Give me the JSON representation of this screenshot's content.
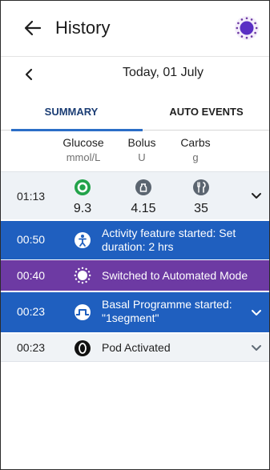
{
  "header": {
    "title": "History"
  },
  "date_nav": {
    "date_label": "Today, 01 July"
  },
  "tabs": [
    {
      "label": "SUMMARY",
      "active": true
    },
    {
      "label": "AUTO EVENTS",
      "active": false
    }
  ],
  "columns": {
    "glucose": {
      "label": "Glucose",
      "unit": "mmol/L"
    },
    "bolus": {
      "label": "Bolus",
      "unit": "U"
    },
    "carbs": {
      "label": "Carbs",
      "unit": "g"
    }
  },
  "summary_row": {
    "time": "01:13",
    "glucose": "9.3",
    "bolus": "4.15",
    "carbs": "35"
  },
  "events": {
    "activity": {
      "time": "00:50",
      "text": "Activity feature started: Set duration: 2 hrs",
      "icon": "activity-icon"
    },
    "automated": {
      "time": "00:40",
      "text": "Switched to Automated Mode",
      "icon": "automated-mode-icon"
    },
    "basal": {
      "time": "00:23",
      "text": "Basal Programme started: \"1segment\"",
      "icon": "basal-icon"
    },
    "pod": {
      "time": "00:23",
      "text": "Pod Activated",
      "icon": "pod-icon"
    }
  },
  "colors": {
    "event_blue": "#1f5fbf",
    "event_purple": "#6d3aa3",
    "glucose_green": "#22a34a",
    "tab_active": "#1b3d74",
    "tab_indicator": "#2b6ec7"
  }
}
